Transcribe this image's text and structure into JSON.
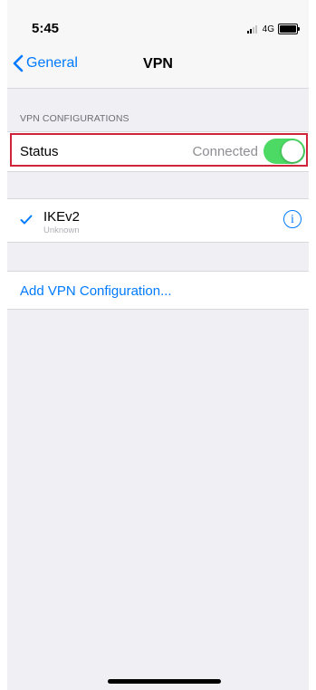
{
  "status_bar": {
    "time": "5:45",
    "network": "4G"
  },
  "nav": {
    "back_label": "General",
    "title": "VPN"
  },
  "section": {
    "header": "VPN CONFIGURATIONS"
  },
  "status_row": {
    "label": "Status",
    "value": "Connected",
    "toggle_on": true
  },
  "vpn_list": [
    {
      "name": "IKEv2",
      "subtitle": "Unknown",
      "selected": true
    }
  ],
  "add_config": {
    "label": "Add VPN Configuration..."
  },
  "colors": {
    "accent": "#007aff",
    "toggle_on": "#4cd964",
    "highlight": "#d0243a",
    "background": "#efeff4"
  }
}
